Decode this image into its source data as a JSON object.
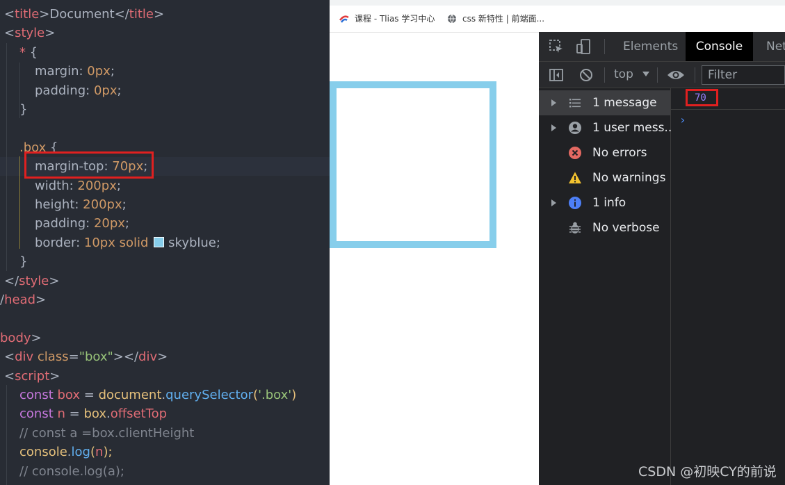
{
  "editor": {
    "lines": [
      {
        "parts": [
          {
            "t": "<",
            "c": "punct"
          },
          {
            "t": "title",
            "c": "tag"
          },
          {
            "t": ">Document</",
            "c": "plain"
          },
          {
            "t": "title",
            "c": "tag"
          },
          {
            "t": ">",
            "c": "punct"
          }
        ]
      },
      {
        "parts": [
          {
            "t": "<",
            "c": "punct"
          },
          {
            "t": "style",
            "c": "tag"
          },
          {
            "t": ">",
            "c": "punct"
          }
        ]
      },
      {
        "parts": [
          {
            "t": "* ",
            "c": "tag"
          },
          {
            "t": "{",
            "c": "punct"
          }
        ]
      },
      {
        "parts": [
          {
            "t": "margin: ",
            "c": "prop"
          },
          {
            "t": "0px",
            "c": "num"
          },
          {
            "t": ";",
            "c": "punct"
          }
        ]
      },
      {
        "parts": [
          {
            "t": "padding: ",
            "c": "prop"
          },
          {
            "t": "0px",
            "c": "num"
          },
          {
            "t": ";",
            "c": "punct"
          }
        ]
      },
      {
        "parts": [
          {
            "t": "}",
            "c": "punct"
          }
        ]
      },
      {
        "parts": []
      },
      {
        "parts": [
          {
            "t": ".box",
            "c": "sel"
          },
          {
            "t": " {",
            "c": "punct"
          }
        ]
      },
      {
        "parts": [
          {
            "t": "margin-top: ",
            "c": "prop"
          },
          {
            "t": "70px",
            "c": "num"
          },
          {
            "t": ";",
            "c": "punct"
          }
        ]
      },
      {
        "parts": [
          {
            "t": "width: ",
            "c": "prop"
          },
          {
            "t": "200px",
            "c": "num"
          },
          {
            "t": ";",
            "c": "punct"
          }
        ]
      },
      {
        "parts": [
          {
            "t": "height: ",
            "c": "prop"
          },
          {
            "t": "200px",
            "c": "num"
          },
          {
            "t": ";",
            "c": "punct"
          }
        ]
      },
      {
        "parts": [
          {
            "t": "padding: ",
            "c": "prop"
          },
          {
            "t": "20px",
            "c": "num"
          },
          {
            "t": ";",
            "c": "punct"
          }
        ]
      },
      {
        "parts": [
          {
            "t": "border: ",
            "c": "prop"
          },
          {
            "t": "10px solid ",
            "c": "num"
          },
          {
            "t": "",
            "c": "swatch"
          },
          {
            "t": "skyblue",
            "c": "plain"
          },
          {
            "t": ";",
            "c": "punct"
          }
        ]
      },
      {
        "parts": [
          {
            "t": "}",
            "c": "punct"
          }
        ]
      },
      {
        "parts": [
          {
            "t": "</",
            "c": "punct"
          },
          {
            "t": "style",
            "c": "tag"
          },
          {
            "t": ">",
            "c": "punct"
          }
        ]
      },
      {
        "parts": [
          {
            "t": "/",
            "c": "punct"
          },
          {
            "t": "head",
            "c": "tag"
          },
          {
            "t": ">",
            "c": "punct"
          }
        ]
      },
      {
        "parts": []
      },
      {
        "parts": [
          {
            "t": "body",
            "c": "tag"
          },
          {
            "t": ">",
            "c": "punct"
          }
        ]
      },
      {
        "parts": [
          {
            "t": "<",
            "c": "punct"
          },
          {
            "t": "div",
            "c": "tag"
          },
          {
            "t": " class",
            "c": "attr"
          },
          {
            "t": "=",
            "c": "punct"
          },
          {
            "t": "\"box\"",
            "c": "str"
          },
          {
            "t": "></",
            "c": "punct"
          },
          {
            "t": "div",
            "c": "tag"
          },
          {
            "t": ">",
            "c": "punct"
          }
        ]
      },
      {
        "parts": [
          {
            "t": "<",
            "c": "punct"
          },
          {
            "t": "script",
            "c": "tag"
          },
          {
            "t": ">",
            "c": "punct"
          }
        ]
      },
      {
        "parts": [
          {
            "t": "const ",
            "c": "kw"
          },
          {
            "t": "box",
            "c": "tag"
          },
          {
            "t": " = ",
            "c": "plain"
          },
          {
            "t": "document",
            "c": "var"
          },
          {
            "t": ".",
            "c": "plain"
          },
          {
            "t": "querySelector",
            "c": "fn"
          },
          {
            "t": "(",
            "c": "var"
          },
          {
            "t": "'.box'",
            "c": "str"
          },
          {
            "t": ")",
            "c": "var"
          }
        ]
      },
      {
        "parts": [
          {
            "t": "const ",
            "c": "kw"
          },
          {
            "t": "n",
            "c": "tag"
          },
          {
            "t": " = ",
            "c": "plain"
          },
          {
            "t": "box",
            "c": "var"
          },
          {
            "t": ".",
            "c": "plain"
          },
          {
            "t": "offsetTop",
            "c": "tag"
          }
        ]
      },
      {
        "parts": [
          {
            "t": "// const a =box.clientHeight",
            "c": "cmt"
          }
        ]
      },
      {
        "parts": [
          {
            "t": "console",
            "c": "var"
          },
          {
            "t": ".",
            "c": "plain"
          },
          {
            "t": "log",
            "c": "fn"
          },
          {
            "t": "(",
            "c": "var"
          },
          {
            "t": "n",
            "c": "tag"
          },
          {
            "t": ");",
            "c": "var"
          }
        ]
      },
      {
        "parts": [
          {
            "t": "// console.log(a);",
            "c": "cmt"
          }
        ]
      }
    ]
  },
  "browser": {
    "bookmarks": [
      {
        "label": "课程 - Tlias 学习中心",
        "icon": "tlias-icon"
      },
      {
        "label": "css 新特性 | 前端面...",
        "icon": "globe-icon"
      }
    ]
  },
  "devtools": {
    "tabs": [
      {
        "label": "Elements",
        "active": false
      },
      {
        "label": "Console",
        "active": true
      },
      {
        "label": "Net",
        "active": false
      }
    ],
    "context": "top",
    "filter_placeholder": "Filter",
    "sidebar": [
      {
        "label": "1 message",
        "icon": "list-icon",
        "expandable": true,
        "selected": true
      },
      {
        "label": "1 user mess...",
        "icon": "user-icon",
        "expandable": true,
        "selected": false
      },
      {
        "label": "No errors",
        "icon": "error-icon",
        "expandable": false,
        "selected": false
      },
      {
        "label": "No warnings",
        "icon": "warning-icon",
        "expandable": false,
        "selected": false
      },
      {
        "label": "1 info",
        "icon": "info-icon",
        "expandable": true,
        "selected": false
      },
      {
        "label": "No verbose",
        "icon": "bug-icon",
        "expandable": false,
        "selected": false
      }
    ],
    "console_output": "70",
    "prompt": "›"
  },
  "watermark": "CSDN @初映CY的前说"
}
